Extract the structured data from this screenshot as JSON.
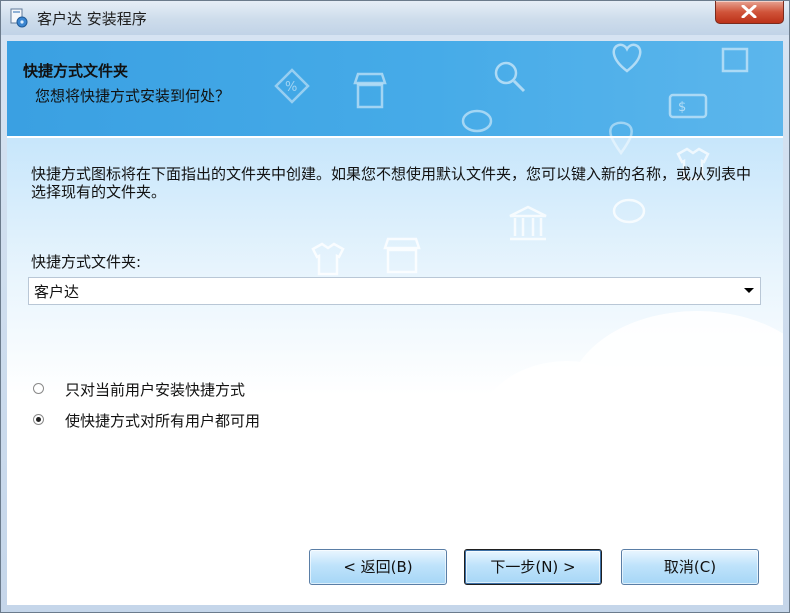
{
  "window": {
    "title": "客户达 安装程序",
    "app_icon": "installer-icon",
    "close_icon": "close-icon"
  },
  "header": {
    "title": "快捷方式文件夹",
    "subtitle": "您想将快捷方式安装到何处？"
  },
  "body": {
    "description": "快捷方式图标将在下面指出的文件夹中创建。如果您不想使用默认文件夹，您可以键入新的名称，或从列表中选择现有的文件夹。",
    "folder_label": "快捷方式文件夹:",
    "folder_value": "客户达"
  },
  "options": [
    {
      "label": "只对当前用户安装快捷方式",
      "checked": false
    },
    {
      "label": "使快捷方式对所有用户都可用",
      "checked": true
    }
  ],
  "buttons": {
    "back": "< 返回(B)",
    "next": "下一步(N) >",
    "cancel": "取消(C)"
  },
  "colors": {
    "header_blue": "#3ea3e3",
    "close_red": "#c8422a"
  }
}
